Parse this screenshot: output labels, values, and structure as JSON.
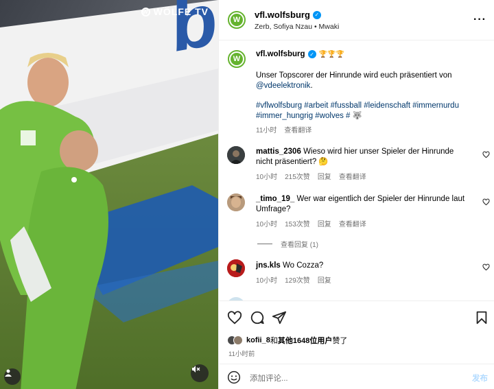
{
  "media": {
    "watermark": "WÖLFE TV",
    "watermark_icon": "wolf-logo-icon",
    "mute_icon": "speaker-muted-icon",
    "tags_icon": "user-tag-icon"
  },
  "header": {
    "username": "vfl.wolfsburg",
    "subtitle": "Zerb, Sofiya Nzau • Mwaki",
    "avatar_letter": "W",
    "more_icon": "more-horizontal-icon",
    "verified_icon": "verified-badge-icon"
  },
  "caption": {
    "username": "vfl.wolfsburg",
    "emoji": "🏆🏆🏆",
    "line1": "Unser Topscorer der Hinrunde wird euch präsentiert von",
    "mention": "@vdeelektronik",
    "mention_suffix": ".",
    "hashtags_line1": "#vflwolfsburg #arbeit #fussball #leidenschaft #immernurdu",
    "hashtags_line2": "#immer_hungrig #wolves # 🐺",
    "time": "11小时",
    "translate": "查看翻译"
  },
  "comments": [
    {
      "username": "mattis_2306",
      "text": "Wieso wird hier unser Spieler der Hinrunde nicht präsentiert? 🤔",
      "time": "10小时",
      "likes": "215次赞",
      "reply": "回复",
      "translate": "查看翻译"
    },
    {
      "username": "_timo_19_",
      "text": "Wer war eigentlich der Spieler der Hinrunde laut Umfrage?",
      "time": "10小时",
      "likes": "153次赞",
      "reply": "回复",
      "translate": "查看翻译",
      "view_replies": "查看回复 (1)"
    },
    {
      "username": "jns.kls",
      "text": "Wo Cozza?",
      "time": "10小时",
      "likes": "129次赞",
      "reply": "回复"
    }
  ],
  "actions": {
    "like_icon": "heart-icon",
    "comment_icon": "comment-icon",
    "share_icon": "send-icon",
    "save_icon": "bookmark-icon",
    "likes_user": "kofii_8",
    "likes_and": "和",
    "likes_others": "其他1648位用户",
    "likes_suffix": "赞了",
    "time": "11小时前"
  },
  "add_comment": {
    "emoji_icon": "emoji-smile-icon",
    "placeholder": "添加评论...",
    "post_label": "发布"
  },
  "colors": {
    "brand_green": "#65b32e",
    "link": "#00376b",
    "verified": "#0095f6",
    "muted_text": "#737373",
    "post_disabled": "#b3dbff"
  }
}
